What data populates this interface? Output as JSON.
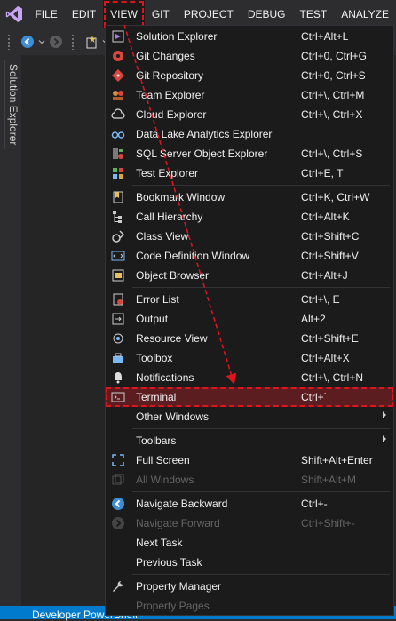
{
  "menubar": {
    "items": [
      "FILE",
      "EDIT",
      "VIEW",
      "GIT",
      "PROJECT",
      "DEBUG",
      "TEST",
      "ANALYZE"
    ]
  },
  "side_panel": {
    "tab_label": "Solution Explorer"
  },
  "status_bar": {
    "text": "Developer PowerShell"
  },
  "colors": {
    "accent": "#007acc",
    "highlight_outline": "#e0141e",
    "menu_bg": "#1b1b1c"
  },
  "view_menu": {
    "groups": [
      [
        {
          "label": "Solution Explorer",
          "shortcut": "Ctrl+Alt+L",
          "icon": "solution-explorer-icon"
        },
        {
          "label": "Git Changes",
          "shortcut": "Ctrl+0, Ctrl+G",
          "icon": "git-changes-icon"
        },
        {
          "label": "Git Repository",
          "shortcut": "Ctrl+0, Ctrl+S",
          "icon": "git-repository-icon"
        },
        {
          "label": "Team Explorer",
          "shortcut": "Ctrl+\\, Ctrl+M",
          "icon": "team-explorer-icon"
        },
        {
          "label": "Cloud Explorer",
          "shortcut": "Ctrl+\\, Ctrl+X",
          "icon": "cloud-icon"
        },
        {
          "label": "Data Lake Analytics Explorer",
          "shortcut": "",
          "icon": "data-lake-icon"
        },
        {
          "label": "SQL Server Object Explorer",
          "shortcut": "Ctrl+\\, Ctrl+S",
          "icon": "sql-server-icon"
        },
        {
          "label": "Test Explorer",
          "shortcut": "Ctrl+E, T",
          "icon": "test-explorer-icon"
        }
      ],
      [
        {
          "label": "Bookmark Window",
          "shortcut": "Ctrl+K, Ctrl+W",
          "icon": "bookmark-icon"
        },
        {
          "label": "Call Hierarchy",
          "shortcut": "Ctrl+Alt+K",
          "icon": "call-hierarchy-icon"
        },
        {
          "label": "Class View",
          "shortcut": "Ctrl+Shift+C",
          "icon": "class-view-icon"
        },
        {
          "label": "Code Definition Window",
          "shortcut": "Ctrl+Shift+V",
          "icon": "code-definition-icon"
        },
        {
          "label": "Object Browser",
          "shortcut": "Ctrl+Alt+J",
          "icon": "object-browser-icon"
        }
      ],
      [
        {
          "label": "Error List",
          "shortcut": "Ctrl+\\, E",
          "icon": "error-list-icon"
        },
        {
          "label": "Output",
          "shortcut": "Alt+2",
          "icon": "output-icon"
        },
        {
          "label": "Resource View",
          "shortcut": "Ctrl+Shift+E",
          "icon": "resource-view-icon"
        },
        {
          "label": "Toolbox",
          "shortcut": "Ctrl+Alt+X",
          "icon": "toolbox-icon"
        },
        {
          "label": "Notifications",
          "shortcut": "Ctrl+\\, Ctrl+N",
          "icon": "bell-icon"
        },
        {
          "label": "Terminal",
          "shortcut": "Ctrl+`",
          "icon": "terminal-icon",
          "highlighted": true
        },
        {
          "label": "Other Windows",
          "shortcut": "",
          "icon": "",
          "submenu": true
        }
      ],
      [
        {
          "label": "Toolbars",
          "shortcut": "",
          "icon": "",
          "submenu": true
        },
        {
          "label": "Full Screen",
          "shortcut": "Shift+Alt+Enter",
          "icon": "full-screen-icon"
        },
        {
          "label": "All Windows",
          "shortcut": "Shift+Alt+M",
          "icon": "all-windows-icon",
          "disabled": true
        }
      ],
      [
        {
          "label": "Navigate Backward",
          "shortcut": "Ctrl+-",
          "icon": "navigate-backward-icon"
        },
        {
          "label": "Navigate Forward",
          "shortcut": "Ctrl+Shift+-",
          "icon": "navigate-forward-icon",
          "disabled": true
        },
        {
          "label": "Next Task",
          "shortcut": "",
          "icon": ""
        },
        {
          "label": "Previous Task",
          "shortcut": "",
          "icon": ""
        }
      ],
      [
        {
          "label": "Property Manager",
          "shortcut": "",
          "icon": "wrench-icon"
        },
        {
          "label": "Property Pages",
          "shortcut": "",
          "icon": "",
          "disabled": true
        }
      ]
    ]
  }
}
